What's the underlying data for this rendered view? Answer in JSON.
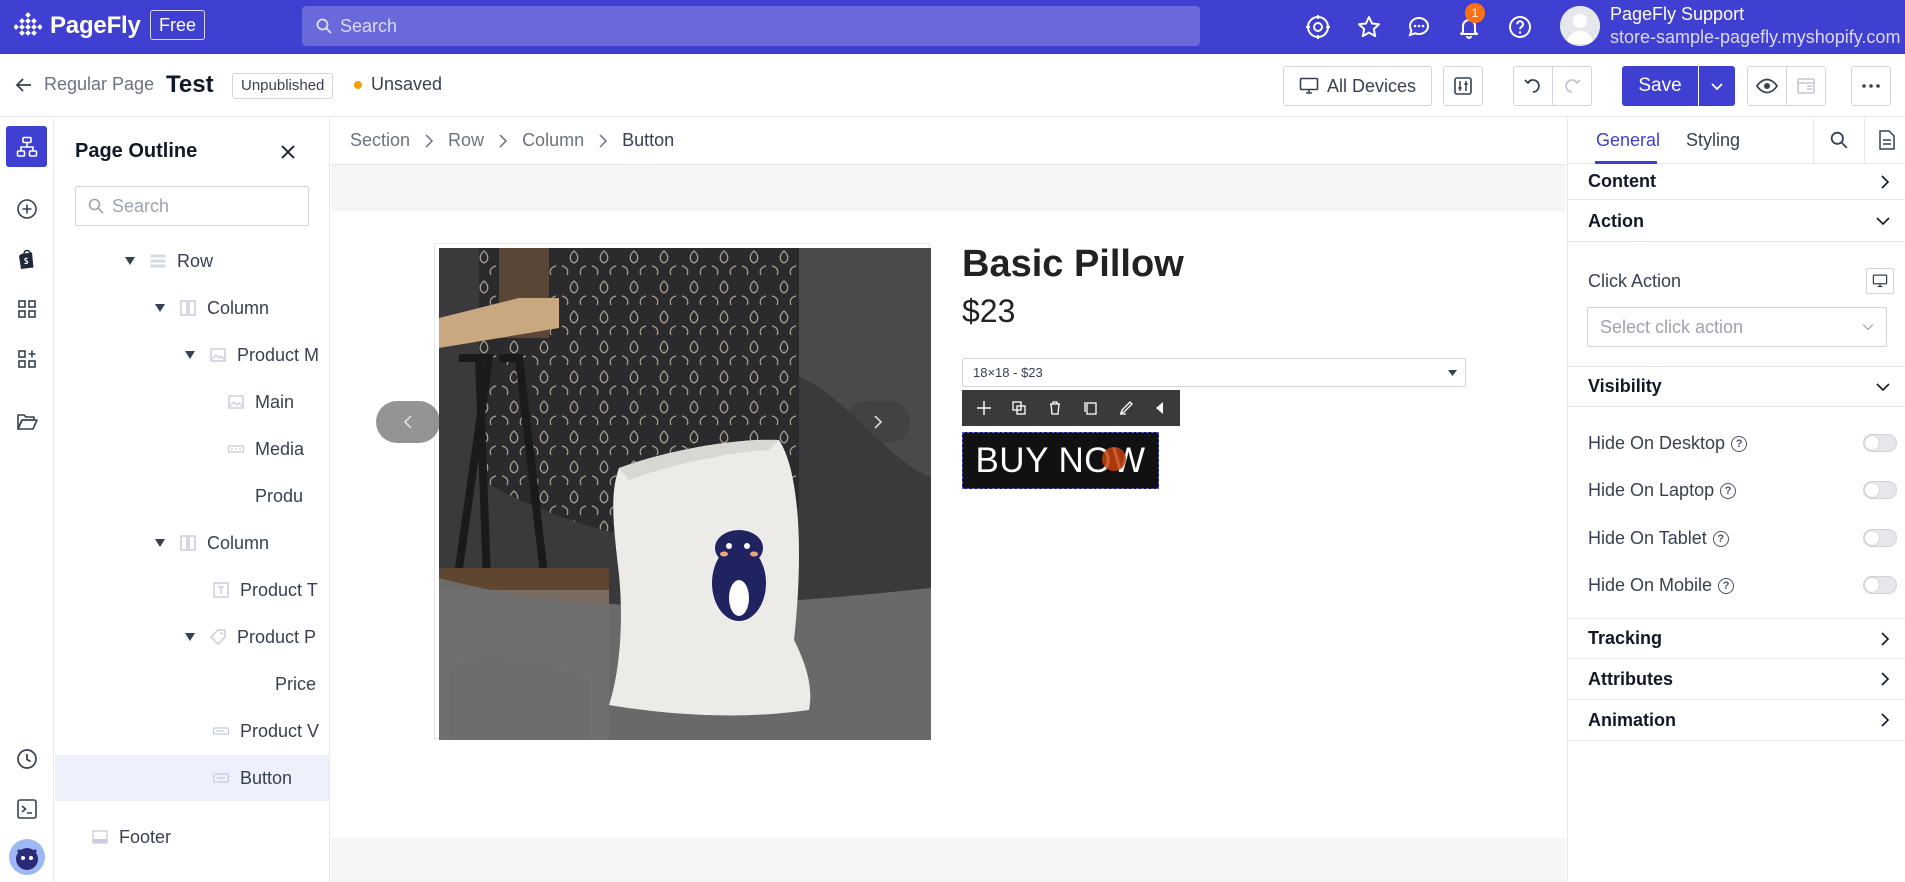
{
  "app": {
    "logo_text": "PageFly",
    "plan_badge": "Free",
    "search_placeholder": "Search",
    "notification_count": "1",
    "user": {
      "name": "PageFly Support",
      "store": "store-sample-pagefly.myshopify.com"
    }
  },
  "editor": {
    "back_label": "Regular Page",
    "page_name": "Test",
    "status": "Unpublished",
    "save_state": "Unsaved",
    "devices_label": "All Devices",
    "save_label": "Save"
  },
  "outline": {
    "title": "Page Outline",
    "search_placeholder": "Search",
    "items": [
      {
        "label": "Row"
      },
      {
        "label": "Column"
      },
      {
        "label": "Product M"
      },
      {
        "label": "Main"
      },
      {
        "label": "Media"
      },
      {
        "label": "Produ"
      },
      {
        "label": "Column"
      },
      {
        "label": "Product T"
      },
      {
        "label": "Product P"
      },
      {
        "label": "Price"
      },
      {
        "label": "Product V"
      },
      {
        "label": "Button"
      },
      {
        "label": "Footer"
      }
    ]
  },
  "canvas": {
    "breadcrumb": [
      "Section",
      "Row",
      "Column",
      "Button"
    ],
    "product": {
      "title": "Basic Pillow",
      "price": "$23",
      "variant": "18×18 - $23",
      "button": "BUY NOW"
    }
  },
  "inspector": {
    "tabs": [
      "General",
      "Styling"
    ],
    "sections": {
      "content": "Content",
      "action": "Action",
      "visibility": "Visibility",
      "tracking": "Tracking",
      "attributes": "Attributes",
      "animation": "Animation"
    },
    "click_action_label": "Click Action",
    "click_action_placeholder": "Select click action",
    "visibility_options": [
      "Hide On Desktop",
      "Hide On Laptop",
      "Hide On Tablet",
      "Hide On Mobile"
    ]
  },
  "colors": {
    "brand": "#3f3fd1",
    "notification": "#f97316",
    "unsaved_dot": "#f59e0b"
  }
}
